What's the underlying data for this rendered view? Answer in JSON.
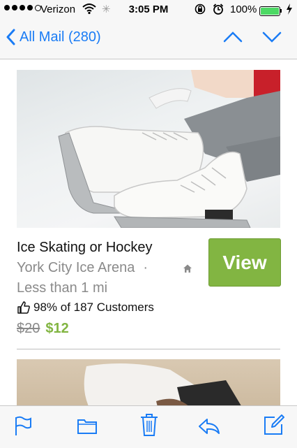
{
  "status_bar": {
    "carrier": "Verizon",
    "time": "3:05 PM",
    "battery": "100%"
  },
  "nav": {
    "back_label": "All Mail (280)"
  },
  "deal": {
    "title": "Ice Skating or Hockey",
    "venue": "York City Ice Arena",
    "separator": "·",
    "distance": "Less than 1 mi",
    "rating": "98% of 187 Customers",
    "old_price": "$20",
    "new_price": "$12",
    "view_label": "View"
  },
  "colors": {
    "accent": "#1a7cf5",
    "view_button": "#82b542",
    "price": "#82b542"
  },
  "icons": {
    "toolbar": [
      "flag-icon",
      "folder-icon",
      "trash-icon",
      "reply-icon",
      "compose-icon"
    ]
  }
}
